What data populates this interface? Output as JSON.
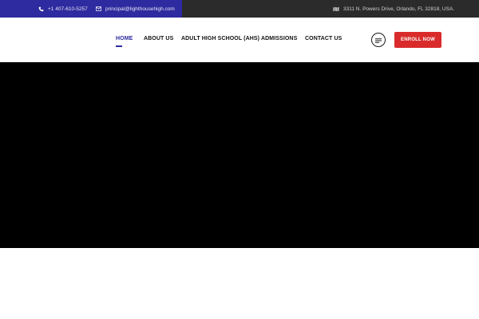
{
  "topbar": {
    "phone": "+1 407-610-5257",
    "email": "principal@lighthousehigh.com",
    "address": "3311 N. Powers Drive, Orlando, FL 32818, USA."
  },
  "nav": {
    "items": [
      {
        "label": "HOME",
        "active": true
      },
      {
        "label": "ABOUT US"
      },
      {
        "label": "ADULT HIGH SCHOOL (AHS)"
      },
      {
        "label": "ADMISSIONS"
      },
      {
        "label": "CONTACT US"
      }
    ]
  },
  "cta": {
    "enroll_label": "ENROLL NOW"
  },
  "icons": {
    "phone": "phone-icon",
    "email": "envelope-icon",
    "address": "map-icon",
    "menu": "menu-lines-icon"
  },
  "colors": {
    "brand_blue": "#2e2a9f",
    "topbar_dark": "#2b2b2b",
    "cta_red": "#d92b2b",
    "hero_bg": "#000000"
  }
}
